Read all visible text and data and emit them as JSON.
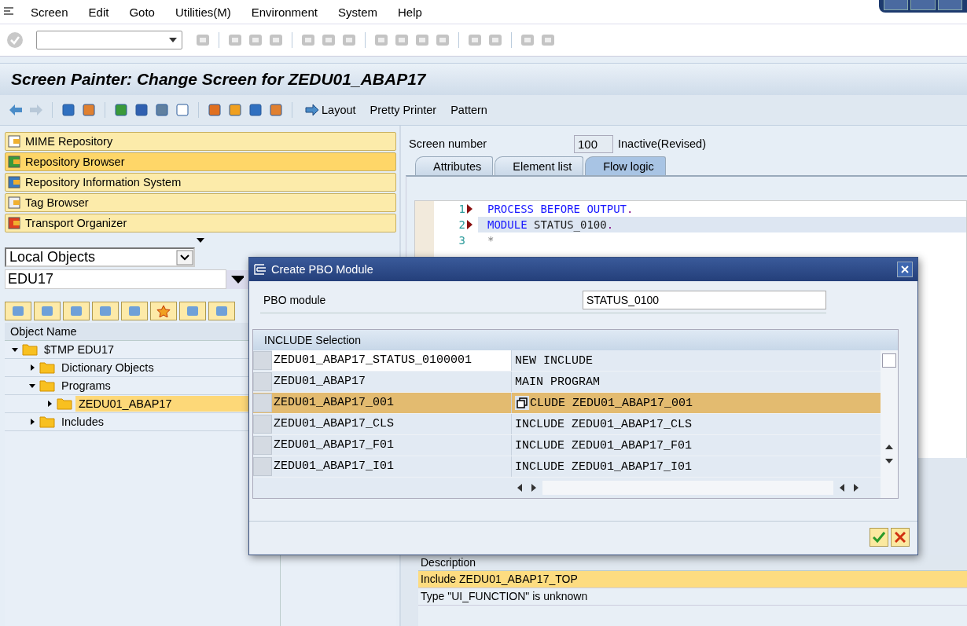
{
  "menu": [
    "Screen",
    "Edit",
    "Goto",
    "Utilities(M)",
    "Environment",
    "System",
    "Help"
  ],
  "title": "Screen Painter: Change Screen for ZEDU01_ABAP17",
  "app_toolbar": {
    "buttons": [
      "Layout",
      "Pretty Printer",
      "Pattern"
    ]
  },
  "nav_buttons": [
    {
      "label": "MIME Repository",
      "selected": false
    },
    {
      "label": "Repository Browser",
      "selected": true
    },
    {
      "label": "Repository Information System",
      "selected": false
    },
    {
      "label": "Tag Browser",
      "selected": false
    },
    {
      "label": "Transport Organizer",
      "selected": false
    }
  ],
  "object_list": {
    "type": "Local Objects",
    "name": "EDU17"
  },
  "tree": {
    "header": "Object Name",
    "items": [
      {
        "label": "$TMP EDU17",
        "expanded": true,
        "selected": false,
        "children": [
          {
            "label": "Dictionary Objects",
            "expanded": false,
            "selected": false
          },
          {
            "label": "Programs",
            "expanded": true,
            "selected": false,
            "children": [
              {
                "label": "ZEDU01_ABAP17",
                "expanded": false,
                "selected": true
              }
            ]
          },
          {
            "label": "Includes",
            "expanded": false,
            "selected": false
          }
        ]
      }
    ]
  },
  "screen": {
    "label": "Screen number",
    "number": "100",
    "status": "Inactive(Revised)"
  },
  "tabs": [
    {
      "label": "Attributes",
      "selected": false
    },
    {
      "label": "Element list",
      "selected": false
    },
    {
      "label": "Flow logic",
      "selected": true
    }
  ],
  "code": [
    {
      "line": "1",
      "marker": true,
      "current": false,
      "parts": [
        {
          "text": "PROCESS BEFORE OUTPUT",
          "kind": "keyword"
        },
        {
          "text": ".",
          "kind": "punct"
        }
      ]
    },
    {
      "line": "2",
      "marker": true,
      "current": true,
      "parts": [
        {
          "text": " MODULE",
          "kind": "keyword"
        },
        {
          "text": " STATUS_0100",
          "kind": "ident"
        },
        {
          "text": ".",
          "kind": "punct"
        }
      ]
    },
    {
      "line": "3",
      "marker": false,
      "current": false,
      "parts": [
        {
          "text": "*",
          "kind": "comment"
        }
      ]
    }
  ],
  "messages": {
    "header": "Description",
    "rows": [
      {
        "text": "Include ZEDU01_ABAP17_TOP",
        "selected": true
      },
      {
        "text": "Type \"UI_FUNCTION\" is unknown",
        "selected": false
      }
    ]
  },
  "dialog": {
    "title": "Create PBO Module",
    "field_label": "PBO module",
    "field_value": "STATUS_0100",
    "table_title": "INCLUDE Selection",
    "rows": [
      {
        "name": "ZEDU01_ABAP17_STATUS_0100001",
        "description": "NEW INCLUDE",
        "selected": false,
        "editable": true
      },
      {
        "name": "ZEDU01_ABAP17",
        "description": "MAIN PROGRAM",
        "selected": false,
        "editable": false
      },
      {
        "name": "ZEDU01_ABAP17_001",
        "description": "CLUDE ZEDU01_ABAP17_001",
        "selected": true,
        "editable": false
      },
      {
        "name": "ZEDU01_ABAP17_CLS",
        "description": "INCLUDE ZEDU01_ABAP17_CLS",
        "selected": false,
        "editable": false
      },
      {
        "name": "ZEDU01_ABAP17_F01",
        "description": "INCLUDE ZEDU01_ABAP17_F01",
        "selected": false,
        "editable": false
      },
      {
        "name": "ZEDU01_ABAP17_I01",
        "description": "INCLUDE ZEDU01_ABAP17_I01",
        "selected": false,
        "editable": false
      }
    ]
  }
}
